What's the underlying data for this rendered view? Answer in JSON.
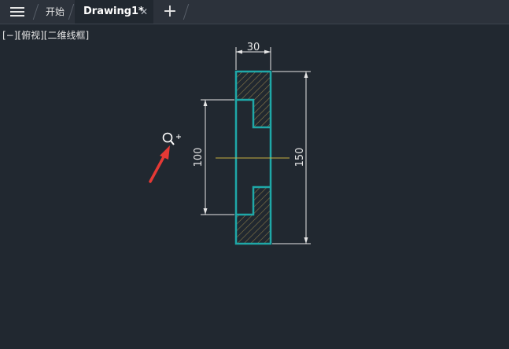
{
  "tabs": {
    "start_label": "开始",
    "active_label": "Drawing1*",
    "close_symbol": "✕",
    "add_symbol": "+"
  },
  "viewport": {
    "label": "[−][俯视][二维线框]"
  },
  "drawing": {
    "dimension_width": "30",
    "dimension_gap": "100",
    "dimension_height": "150"
  },
  "colors": {
    "background": "#212830",
    "part_outline": "#1fa8a8",
    "hatch": "#8a7a4a",
    "dimension": "#e6e6e6",
    "centerline": "#c8b040",
    "arrow": "#e53935"
  },
  "icons": {
    "menu": "hamburger-menu-icon",
    "zoom": "zoom-in-cursor-icon"
  }
}
